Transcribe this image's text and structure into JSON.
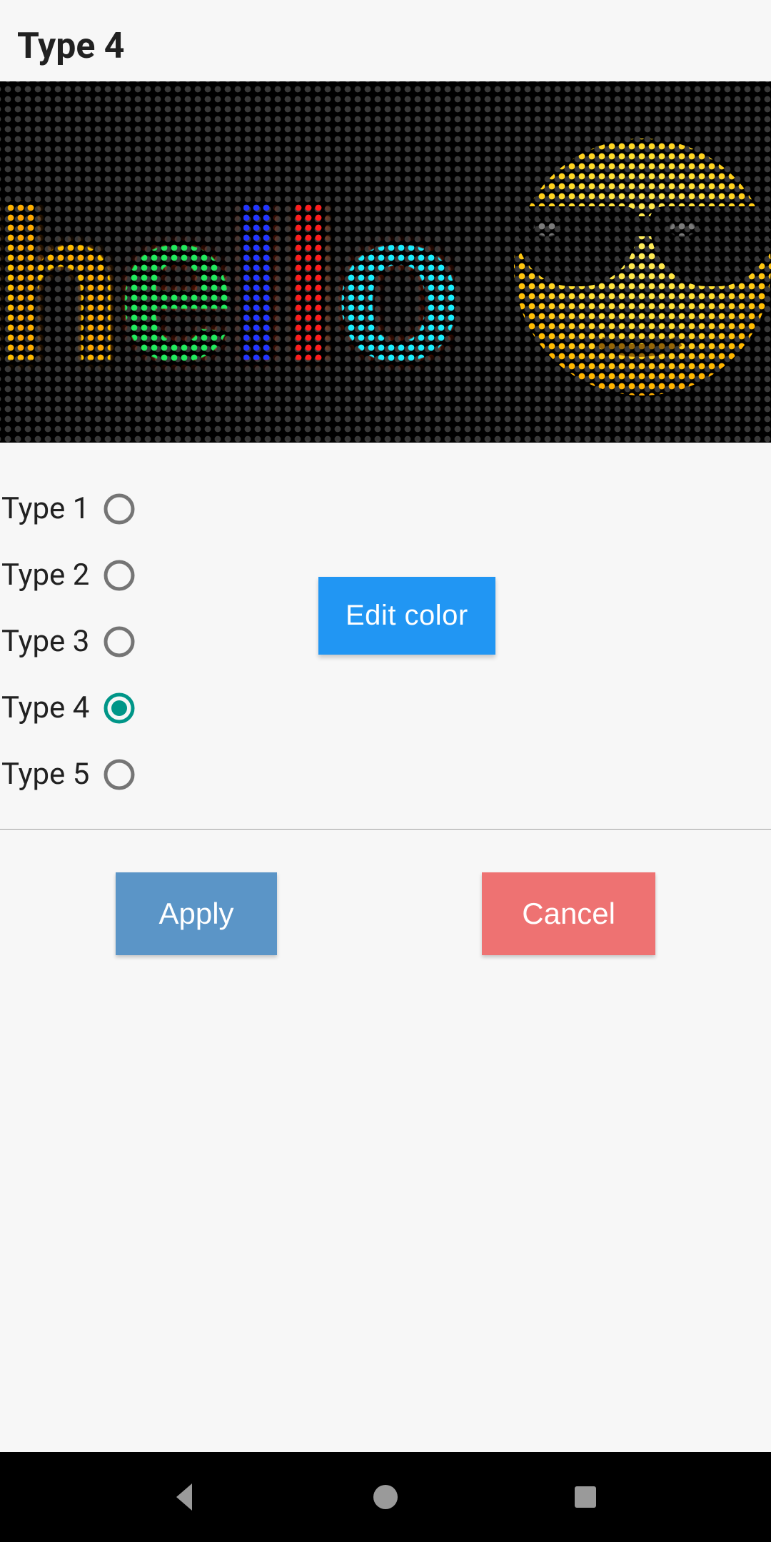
{
  "header": {
    "title": "Type 4"
  },
  "preview": {
    "text": "hello",
    "letters": [
      "h",
      "e",
      "l",
      "l",
      "o"
    ],
    "emoji": "sunglasses-face"
  },
  "types": {
    "items": [
      {
        "label": "Type 1",
        "selected": false
      },
      {
        "label": "Type 2",
        "selected": false
      },
      {
        "label": "Type 3",
        "selected": false
      },
      {
        "label": "Type 4",
        "selected": true
      },
      {
        "label": "Type 5",
        "selected": false
      }
    ]
  },
  "buttons": {
    "edit_color": "Edit color",
    "apply": "Apply",
    "cancel": "Cancel"
  },
  "colors": {
    "accent": "#009688",
    "primary_button": "#2196f3",
    "apply_button": "#5b95c7",
    "cancel_button": "#ee7272"
  }
}
